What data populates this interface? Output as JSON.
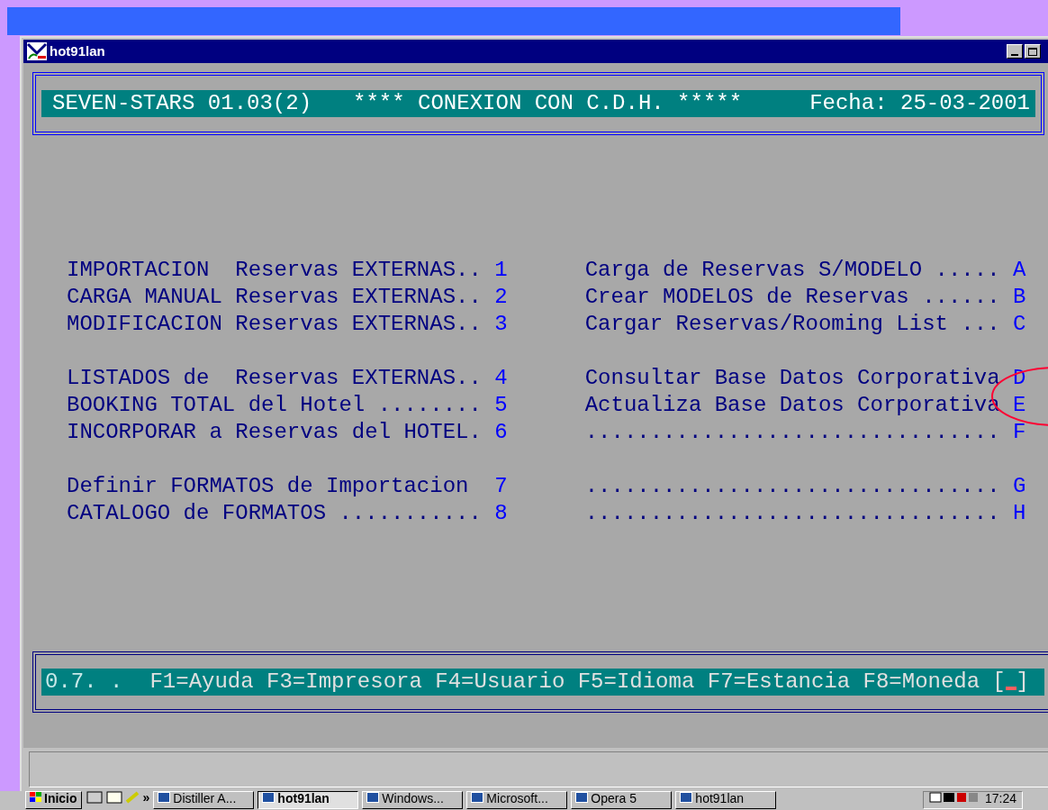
{
  "window": {
    "title": "hot91lan"
  },
  "header": {
    "left": "SEVEN-STARS 01.03(2)",
    "center": "**** CONEXION CON C.D.H. *****",
    "right": "Fecha: 25-03-2001"
  },
  "menu_left": [
    [
      {
        "label": "IMPORTACION  Reservas EXTERNAS..",
        "key": "1"
      },
      {
        "label": "CARGA MANUAL Reservas EXTERNAS..",
        "key": "2"
      },
      {
        "label": "MODIFICACION Reservas EXTERNAS..",
        "key": "3"
      }
    ],
    [
      {
        "label": "LISTADOS de  Reservas EXTERNAS..",
        "key": "4"
      },
      {
        "label": "BOOKING TOTAL del Hotel ........",
        "key": "5"
      },
      {
        "label": "INCORPORAR a Reservas del HOTEL.",
        "key": "6"
      }
    ],
    [
      {
        "label": "Definir FORMATOS de Importacion ",
        "key": "7"
      },
      {
        "label": "CATALOGO de FORMATOS ...........",
        "key": "8"
      }
    ]
  ],
  "menu_right": [
    [
      {
        "label": "Carga de Reservas S/MODELO .....",
        "key": "A"
      },
      {
        "label": "Crear MODELOS de Reservas ......",
        "key": "B"
      },
      {
        "label": "Cargar Reservas/Rooming List ...",
        "key": "C"
      }
    ],
    [
      {
        "label": "Consultar Base Datos Corporativa",
        "key": "D"
      },
      {
        "label": "Actualiza Base Datos Corporativa",
        "key": "E"
      },
      {
        "label": "................................",
        "key": "F"
      }
    ],
    [
      {
        "label": "................................",
        "key": "G"
      },
      {
        "label": "................................",
        "key": "H"
      }
    ]
  ],
  "footer": {
    "version": "0.7. .",
    "keys": "F1=Ayuda F3=Impresora F4=Usuario F5=Idioma F7=Estancia F8=Moneda",
    "open": "[",
    "close": "]"
  },
  "taskbar": {
    "start": "Inicio",
    "more": "»",
    "tasks": [
      {
        "label": "Distiller A...",
        "pressed": false
      },
      {
        "label": "hot91lan",
        "pressed": true
      },
      {
        "label": "Windows...",
        "pressed": false
      },
      {
        "label": "Microsoft...",
        "pressed": false
      },
      {
        "label": "Opera 5",
        "pressed": false
      },
      {
        "label": "hot91lan",
        "pressed": false
      }
    ],
    "clock": "17:24"
  }
}
